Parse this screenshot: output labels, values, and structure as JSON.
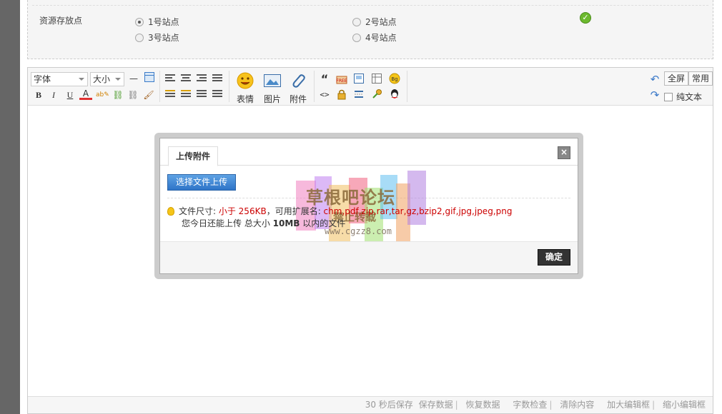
{
  "site_panel": {
    "label": "资源存放点",
    "options": [
      {
        "label": "1号站点",
        "selected": true
      },
      {
        "label": "2号站点",
        "selected": false
      },
      {
        "label": "3号站点",
        "selected": false
      },
      {
        "label": "4号站点",
        "selected": false
      }
    ]
  },
  "toolbar": {
    "font_select": "字体",
    "size_select": "大小",
    "bold": "B",
    "italic": "I",
    "underline": "U",
    "font_color": "A",
    "emoticon_label": "表情",
    "image_label": "图片",
    "attachment_label": "附件",
    "quote": "“",
    "code": "<>",
    "fullscreen": "全屏",
    "common": "常用",
    "plain_text": "纯文本"
  },
  "dialog": {
    "tab": "上传附件",
    "close": "×",
    "upload_button": "选择文件上传",
    "info_prefix": "文件尺寸: ",
    "info_size": "小于 256KB",
    "info_ext_label": "，可用扩展名: ",
    "info_ext": "chm,pdf,zip,rar,tar,gz,bzip2,gif,jpg,jpeg,png",
    "line2_prefix": "您今日还能上传 总大小 ",
    "line2_size": "10MB",
    "line2_suffix": " 以内的文件",
    "ok_button": "确定",
    "watermark": {
      "title": "草根吧论坛",
      "subtitle": "禁止转载",
      "url": "www.cgzz8.com"
    }
  },
  "statusbar": {
    "autosave": "30 秒后保存",
    "save": "保存数据",
    "restore": "恢复数据",
    "word_check": "字数检查",
    "clear": "清除内容",
    "enlarge": "加大编辑框",
    "shrink": "缩小编辑框"
  },
  "colors": {
    "accent_blue": "#2e74c8",
    "warn_red": "#cc0000",
    "ok_green": "#6cb92e"
  }
}
